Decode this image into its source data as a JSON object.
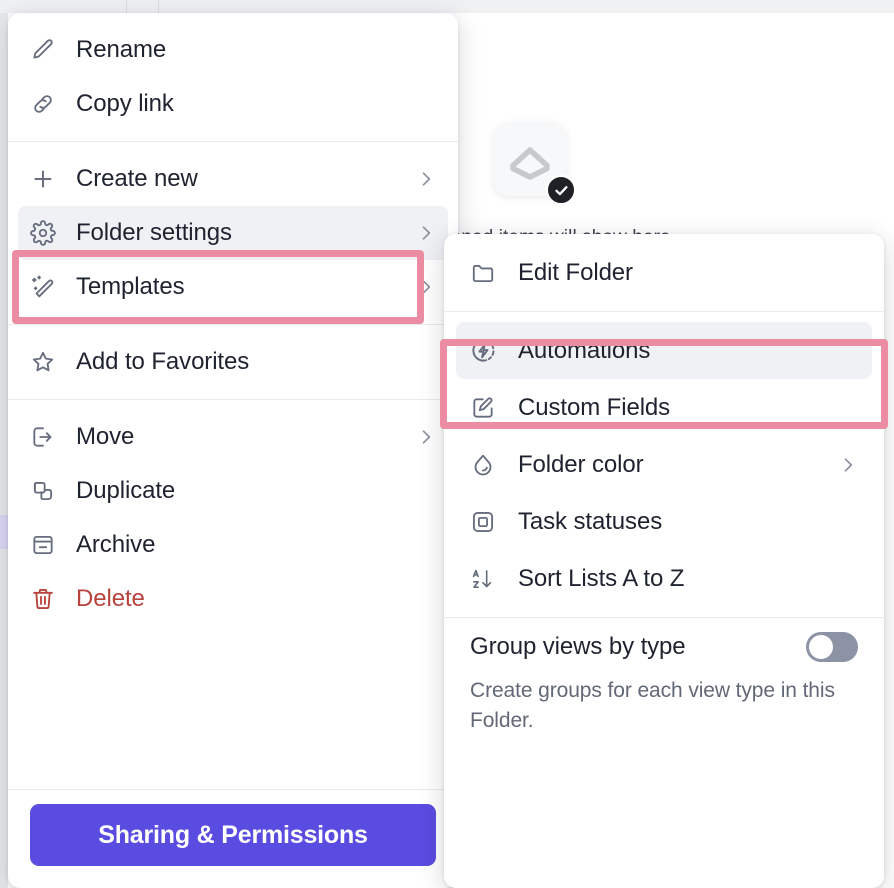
{
  "background": {
    "hint_text": "pened items will show here",
    "logo_icon": "clickup-logo-icon",
    "badge_icon": "check-circle-icon"
  },
  "colors": {
    "highlight_pink": "#eb8ca2",
    "primary_button": "#5a4ce0",
    "danger_text": "#b8423c",
    "selected_row": "#f0f1f4",
    "toggle_track": "#8b93a5"
  },
  "context_menu": {
    "sections": [
      {
        "items": [
          {
            "label": "Rename",
            "icon": "pencil-icon",
            "has_submenu": false
          },
          {
            "label": "Copy link",
            "icon": "link-icon",
            "has_submenu": false
          }
        ]
      },
      {
        "items": [
          {
            "label": "Create new",
            "icon": "plus-icon",
            "has_submenu": true
          },
          {
            "label": "Folder settings",
            "icon": "gear-icon",
            "has_submenu": true,
            "selected": true,
            "highlighted": true
          },
          {
            "label": "Templates",
            "icon": "magic-wand-icon",
            "has_submenu": true
          }
        ]
      },
      {
        "items": [
          {
            "label": "Add to Favorites",
            "icon": "star-icon",
            "has_submenu": false
          }
        ]
      },
      {
        "items": [
          {
            "label": "Move",
            "icon": "move-out-icon",
            "has_submenu": true
          },
          {
            "label": "Duplicate",
            "icon": "duplicate-icon",
            "has_submenu": false
          },
          {
            "label": "Archive",
            "icon": "archive-icon",
            "has_submenu": false
          },
          {
            "label": "Delete",
            "icon": "trash-icon",
            "has_submenu": false,
            "danger": true
          }
        ]
      }
    ],
    "footer": {
      "sharing_button_label": "Sharing & Permissions"
    }
  },
  "folder_settings_submenu": {
    "sections": [
      {
        "items": [
          {
            "label": "Edit Folder",
            "icon": "folder-icon",
            "has_submenu": false
          }
        ]
      },
      {
        "items": [
          {
            "label": "Automations",
            "icon": "automations-bolt-icon",
            "has_submenu": false,
            "selected": true,
            "highlighted": true
          },
          {
            "label": "Custom Fields",
            "icon": "edit-square-icon",
            "has_submenu": false
          },
          {
            "label": "Folder color",
            "icon": "droplet-icon",
            "has_submenu": true
          },
          {
            "label": "Task statuses",
            "icon": "status-square-icon",
            "has_submenu": false
          },
          {
            "label": "Sort Lists A to Z",
            "icon": "sort-az-icon",
            "has_submenu": false
          }
        ]
      }
    ],
    "group_views": {
      "label": "Group views by type",
      "description": "Create groups for each view type in this Folder.",
      "enabled": false
    }
  }
}
